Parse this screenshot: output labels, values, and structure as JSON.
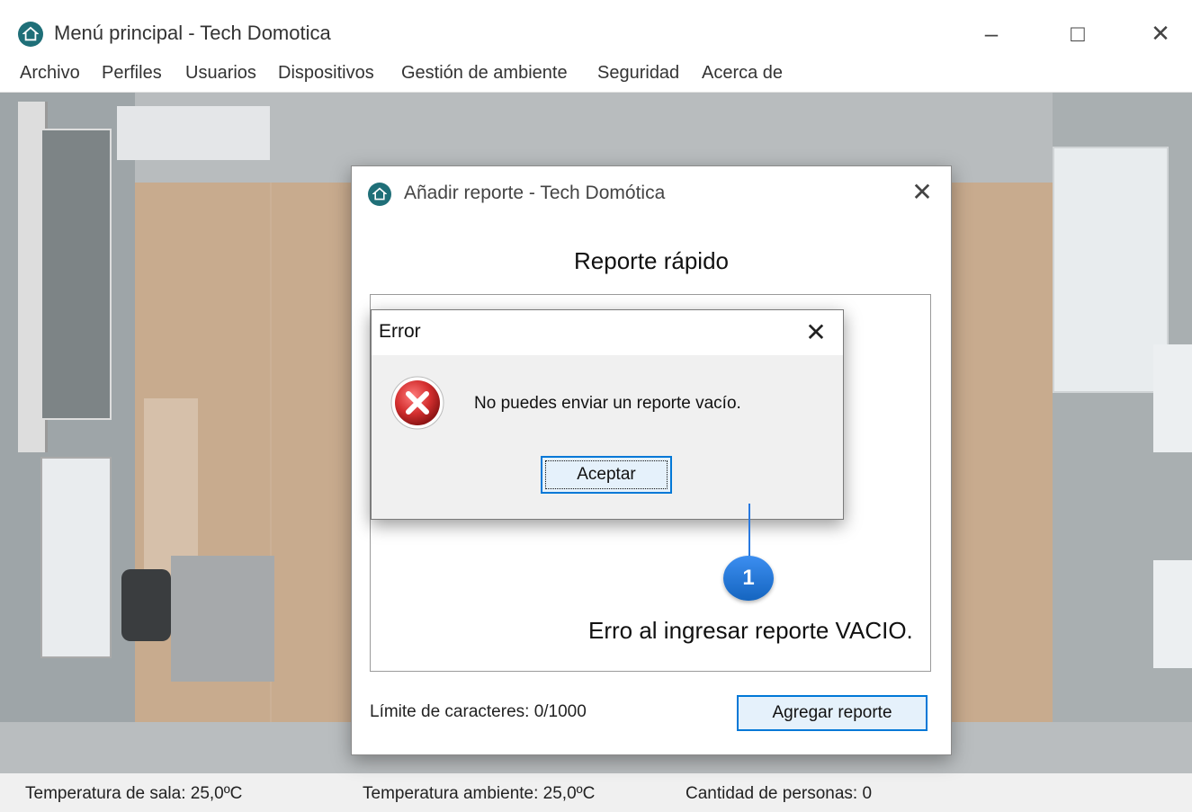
{
  "window": {
    "title": "Menú principal - Tech Domotica",
    "minimize": "–",
    "maximize": "□",
    "close": "✕"
  },
  "menu": {
    "items": [
      "Archivo",
      "Perfiles",
      "Usuarios",
      "Dispositivos",
      "Gestión de ambiente",
      "Seguridad",
      "Acerca de"
    ]
  },
  "status": {
    "room_temp": "Temperatura de sala: 25,0ºC",
    "ambient_temp": "Temperatura ambiente: 25,0ºC",
    "people": "Cantidad de personas: 0"
  },
  "report_dialog": {
    "title": "Añadir reporte - Tech Domótica",
    "close": "✕",
    "heading": "Reporte rápido",
    "counter": "Límite de caracteres: 0/1000",
    "add_button": "Agregar reporte"
  },
  "error_dialog": {
    "title": "Error",
    "close": "✕",
    "message": "No puedes enviar un reporte vacío.",
    "accept_button": "Aceptar"
  },
  "callout": {
    "number": "1",
    "text": "Erro al ingresar reporte VACIO."
  },
  "colors": {
    "accent_blue": "#0078d7",
    "app_icon": "#1f6f78",
    "error_red": "#d32f2f",
    "callout_blue": "#1e88e5"
  }
}
